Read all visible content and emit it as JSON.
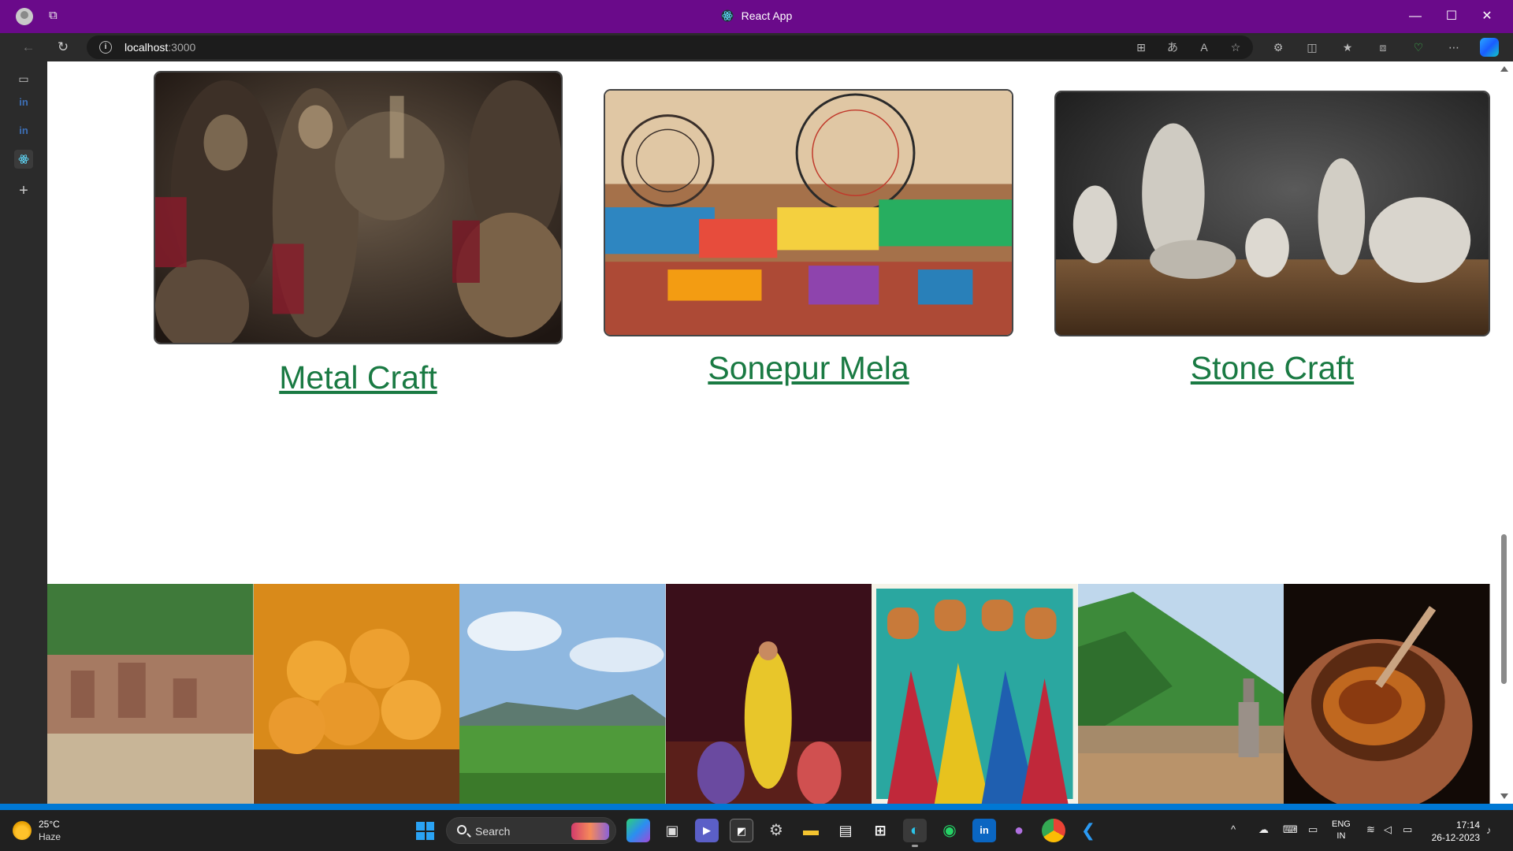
{
  "window": {
    "title": "React App"
  },
  "address": {
    "host": "localhost",
    "port": ":3000"
  },
  "cards": [
    {
      "label": "Metal Craft"
    },
    {
      "label": "Sonepur Mela"
    },
    {
      "label": "Stone Craft"
    }
  ],
  "strip_images": [
    "river ghats with temples",
    "ladoo sweets in bowl",
    "valley landscape with green fields",
    "classical dancers on stage",
    "folk painting of women carrying pots",
    "hills with lake and monument",
    "pickle in clay pot"
  ],
  "taskbar": {
    "weather_temp": "25°C",
    "weather_cond": "Haze",
    "search_label": "Search",
    "lang_top": "ENG",
    "lang_bottom": "IN",
    "time": "17:14",
    "date": "26-12-2023"
  },
  "colors": {
    "titlebar": "#6a0a8a",
    "link": "#1a7a43",
    "accent": "#0078d4"
  }
}
